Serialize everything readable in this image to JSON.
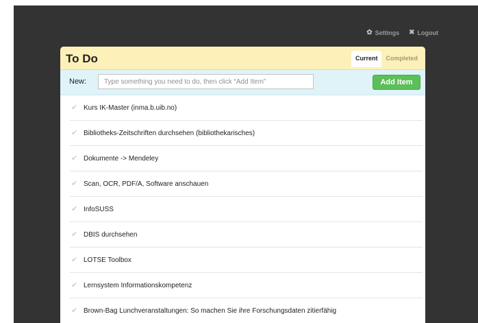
{
  "topnav": {
    "settings_label": "Settings",
    "settings_icon": "gear-icon",
    "logout_label": "Logout",
    "logout_icon": "x-icon"
  },
  "panel": {
    "title": "To Do",
    "tabs": [
      {
        "label": "Current",
        "active": true
      },
      {
        "label": "Completed",
        "active": false
      }
    ]
  },
  "new_item": {
    "label": "New:",
    "placeholder": "Type something you need to do, then click “Add Item”",
    "value": "",
    "button_label": "Add Item"
  },
  "items": [
    {
      "text": "Kurs IK-Master (inma.b.uib.no)"
    },
    {
      "text": "Bibliotheks-Zeitschriften durchsehen (bibliothekarisches)"
    },
    {
      "text": "Dokumente -> Mendeley"
    },
    {
      "text": "Scan, OCR, PDF/A, Software anschauen"
    },
    {
      "text": "InfoSUSS"
    },
    {
      "text": "DBIS durchsehen"
    },
    {
      "text": "LOTSE Toolbox"
    },
    {
      "text": "Lernsystem Informationskompetenz"
    },
    {
      "text": "Brown-Bag Lunchveranstaltungen: So machen Sie ihre Forschungsdaten zitierfähig"
    }
  ],
  "colors": {
    "background": "#333333",
    "header": "#fdf1b9",
    "new_row": "#dff3f8",
    "add_button": "#5bbf5a"
  }
}
